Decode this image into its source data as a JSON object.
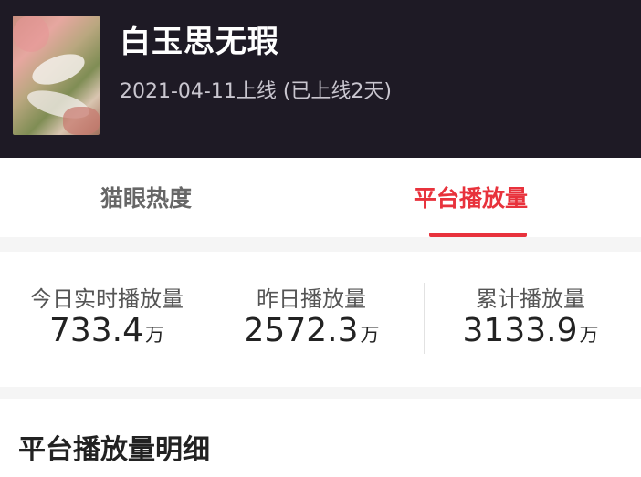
{
  "show": {
    "title": "白玉思无瑕",
    "release_info": "2021-04-11上线 (已上线2天)"
  },
  "tabs": [
    {
      "label": "猫眼热度",
      "active": false
    },
    {
      "label": "平台播放量",
      "active": true
    }
  ],
  "stats": [
    {
      "label": "今日实时播放量",
      "value": "733.4",
      "unit": "万"
    },
    {
      "label": "昨日播放量",
      "value": "2572.3",
      "unit": "万"
    },
    {
      "label": "累计播放量",
      "value": "3133.9",
      "unit": "万"
    }
  ],
  "detail": {
    "title": "平台播放量明细"
  },
  "colors": {
    "header_bg": "#1e1a25",
    "accent": "#e8323c"
  }
}
